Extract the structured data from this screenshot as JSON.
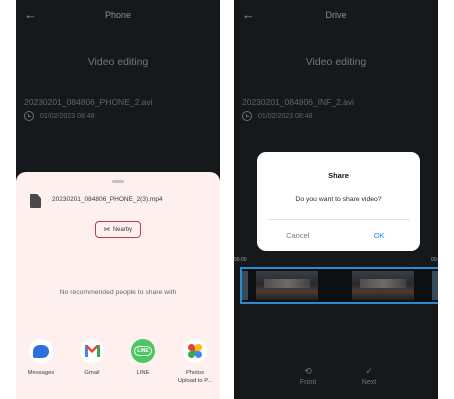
{
  "left": {
    "header": {
      "title": "Phone"
    },
    "video_title": "Video editing",
    "file_name": "20230201_084806_PHONE_2.avi",
    "date": "01/02/2023 08:48",
    "share_sheet": {
      "file_name": "20230201_084806_PHONE_2(3).mp4",
      "nearby_label": "Nearby",
      "no_people": "No recommended people to share with",
      "apps": [
        {
          "label": "Messages",
          "icon": "messages-icon"
        },
        {
          "label": "Gmail",
          "icon": "gmail-icon"
        },
        {
          "label": "LINE",
          "icon": "line-icon",
          "badge_text": "LINE"
        },
        {
          "label": "Photos",
          "sublabel": "Upload to P...",
          "icon": "photos-icon"
        }
      ]
    }
  },
  "right": {
    "header": {
      "title": "Drive"
    },
    "video_title": "Video editing",
    "file_name": "20230201_084806_INF_2.avi",
    "date": "01/02/2023 08:48",
    "dialog": {
      "title": "Share",
      "message": "Do you want to share video?",
      "cancel_label": "Cancel",
      "ok_label": "OK"
    },
    "timeline": {
      "start_label": "00:00",
      "end_label": "00:"
    },
    "bottom_bar": {
      "front_label": "Front",
      "next_label": "Next"
    }
  },
  "colors": {
    "background_dark": "#16191c",
    "sheet_background": "#fdf0ef",
    "nearby_border": "#b84049",
    "dialog_ok": "#1e90ff",
    "timeline_border": "#2b8bd1"
  }
}
